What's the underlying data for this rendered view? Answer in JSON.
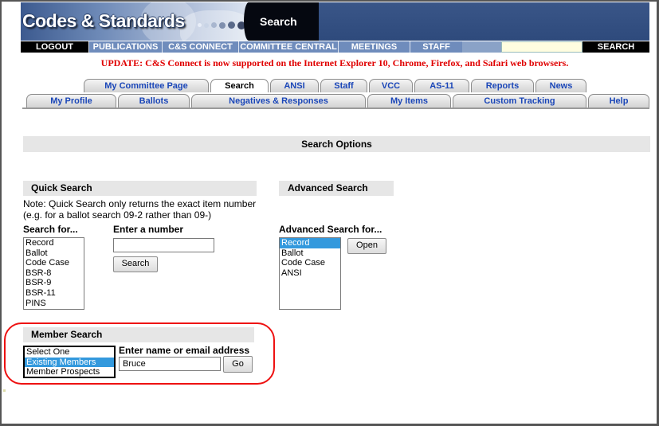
{
  "header": {
    "site_title": "Codes & Standards",
    "page_heading": "Search"
  },
  "navbar": {
    "items": [
      {
        "label": "LOGOUT",
        "style": "black"
      },
      {
        "label": "PUBLICATIONS",
        "style": "blue"
      },
      {
        "label": "C&S CONNECT",
        "style": "blue"
      },
      {
        "label": "COMMITTEE CENTRAL",
        "style": "blue"
      },
      {
        "label": "MEETINGS",
        "style": "blue"
      },
      {
        "label": "STAFF",
        "style": "blue"
      }
    ],
    "search_value": "",
    "search_button": "SEARCH"
  },
  "update_notice": "UPDATE: C&S Connect is now supported on the Internet Explorer 10, Chrome, Firefox, and Safari web browsers.",
  "tabs_row1": [
    {
      "label": "My Committee Page",
      "active": false
    },
    {
      "label": "Search",
      "active": true
    },
    {
      "label": "ANSI",
      "active": false
    },
    {
      "label": "Staff",
      "active": false
    },
    {
      "label": "VCC",
      "active": false
    },
    {
      "label": "AS-11",
      "active": false
    },
    {
      "label": "Reports",
      "active": false
    },
    {
      "label": "News",
      "active": false
    }
  ],
  "tabs_row2": [
    {
      "label": "My Profile"
    },
    {
      "label": "Ballots"
    },
    {
      "label": "Negatives & Responses"
    },
    {
      "label": "My Items"
    },
    {
      "label": "Custom Tracking"
    },
    {
      "label": "Help"
    }
  ],
  "search_options": {
    "title": "Search Options"
  },
  "quick_search": {
    "title": "Quick Search",
    "note_line1": "Note: Quick Search only returns the exact item number",
    "note_line2": "(e.g. for a ballot search 09-2 rather than 09-)",
    "search_for_label": "Search for...",
    "options": [
      "Record",
      "Ballot",
      "Code Case",
      "BSR-8",
      "BSR-9",
      "BSR-11",
      "PINS"
    ],
    "selected": "",
    "number_label": "Enter a number",
    "number_value": "",
    "search_button": "Search"
  },
  "advanced_search": {
    "title": "Advanced Search",
    "for_label": "Advanced Search for...",
    "options": [
      "Record",
      "Ballot",
      "Code Case",
      "ANSI"
    ],
    "selected": "Record",
    "open_button": "Open"
  },
  "member_search": {
    "title": "Member Search",
    "options": [
      "Select One",
      "Existing Members",
      "Member Prospects"
    ],
    "selected": "Existing Members",
    "name_label": "Enter name or email address",
    "name_value": "Bruce",
    "go_button": "Go"
  },
  "colors": {
    "update_red": "#e00000",
    "tab_text_blue": "#1a46b8",
    "selection_blue": "#3399dd",
    "highlight_red": "#ee1111"
  }
}
